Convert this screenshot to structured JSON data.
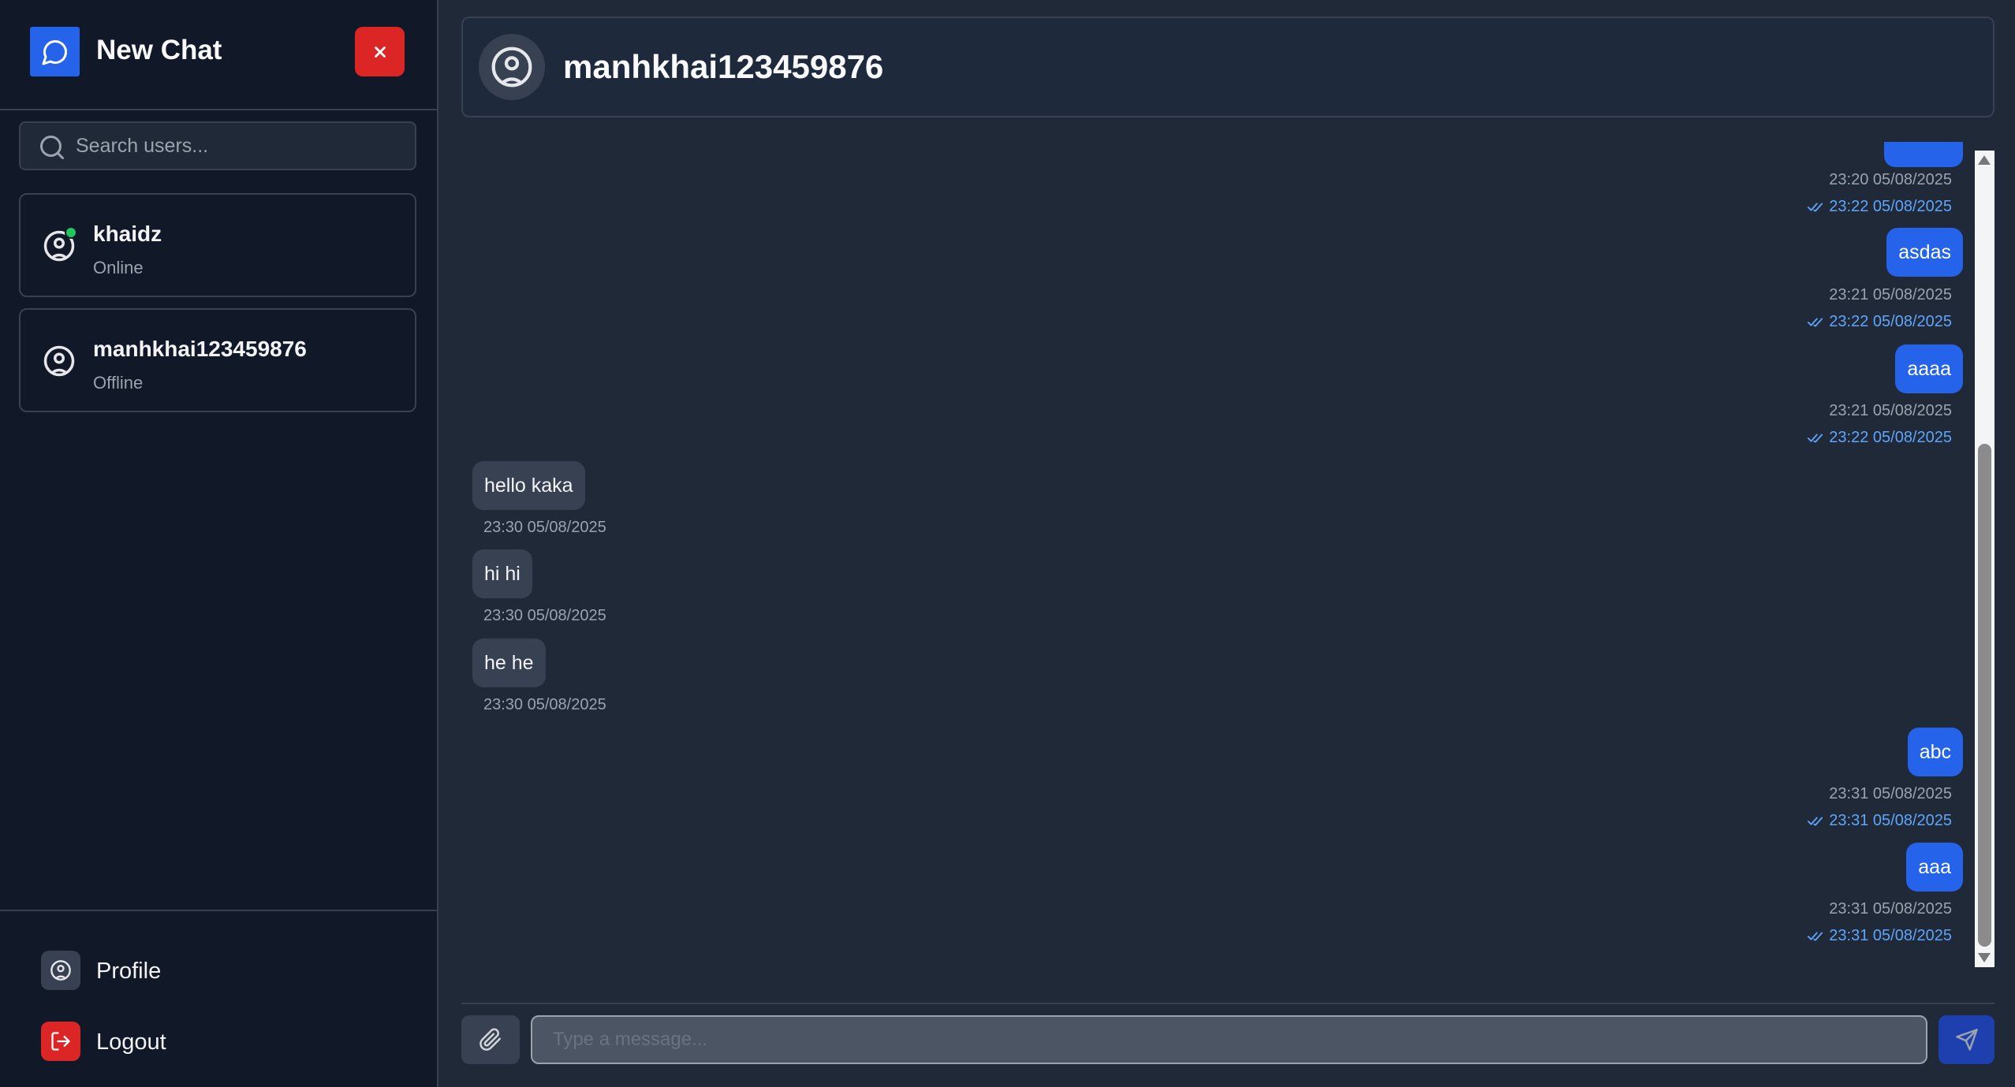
{
  "sidebar": {
    "title": "New Chat",
    "search_placeholder": "Search users...",
    "users": [
      {
        "name": "khaidz",
        "status": "Online"
      },
      {
        "name": "manhkhai123459876",
        "status": "Offline"
      }
    ],
    "footer": {
      "profile_label": "Profile",
      "logout_label": "Logout"
    }
  },
  "chat": {
    "contact_name": "manhkhai123459876",
    "messages": [
      {
        "side": "mine",
        "text": "",
        "sent": "23:20 05/08/2025",
        "read": "23:22 05/08/2025"
      },
      {
        "side": "mine",
        "text": "asdas",
        "sent": "23:21 05/08/2025",
        "read": "23:22 05/08/2025"
      },
      {
        "side": "mine",
        "text": "aaaa",
        "sent": "23:21 05/08/2025",
        "read": "23:22 05/08/2025"
      },
      {
        "side": "theirs",
        "text": "hello kaka",
        "sent": "23:30 05/08/2025"
      },
      {
        "side": "theirs",
        "text": "hi hi",
        "sent": "23:30 05/08/2025"
      },
      {
        "side": "theirs",
        "text": "he he",
        "sent": "23:30 05/08/2025"
      },
      {
        "side": "mine",
        "text": "abc",
        "sent": "23:31 05/08/2025",
        "read": "23:31 05/08/2025"
      },
      {
        "side": "mine",
        "text": "aaa",
        "sent": "23:31 05/08/2025",
        "read": "23:31 05/08/2025"
      }
    ],
    "input_placeholder": "Type a message..."
  },
  "colors": {
    "sidebar_bg": "#111827",
    "main_bg": "#1f2937",
    "accent": "#2563eb",
    "danger": "#dc2626",
    "online": "#22c55e",
    "read_receipt": "#60a5fa"
  },
  "icons": [
    "chat-bubble-icon",
    "close-icon",
    "search-icon",
    "user-circle-icon",
    "logout-icon",
    "paperclip-icon",
    "send-icon",
    "double-check-icon"
  ]
}
